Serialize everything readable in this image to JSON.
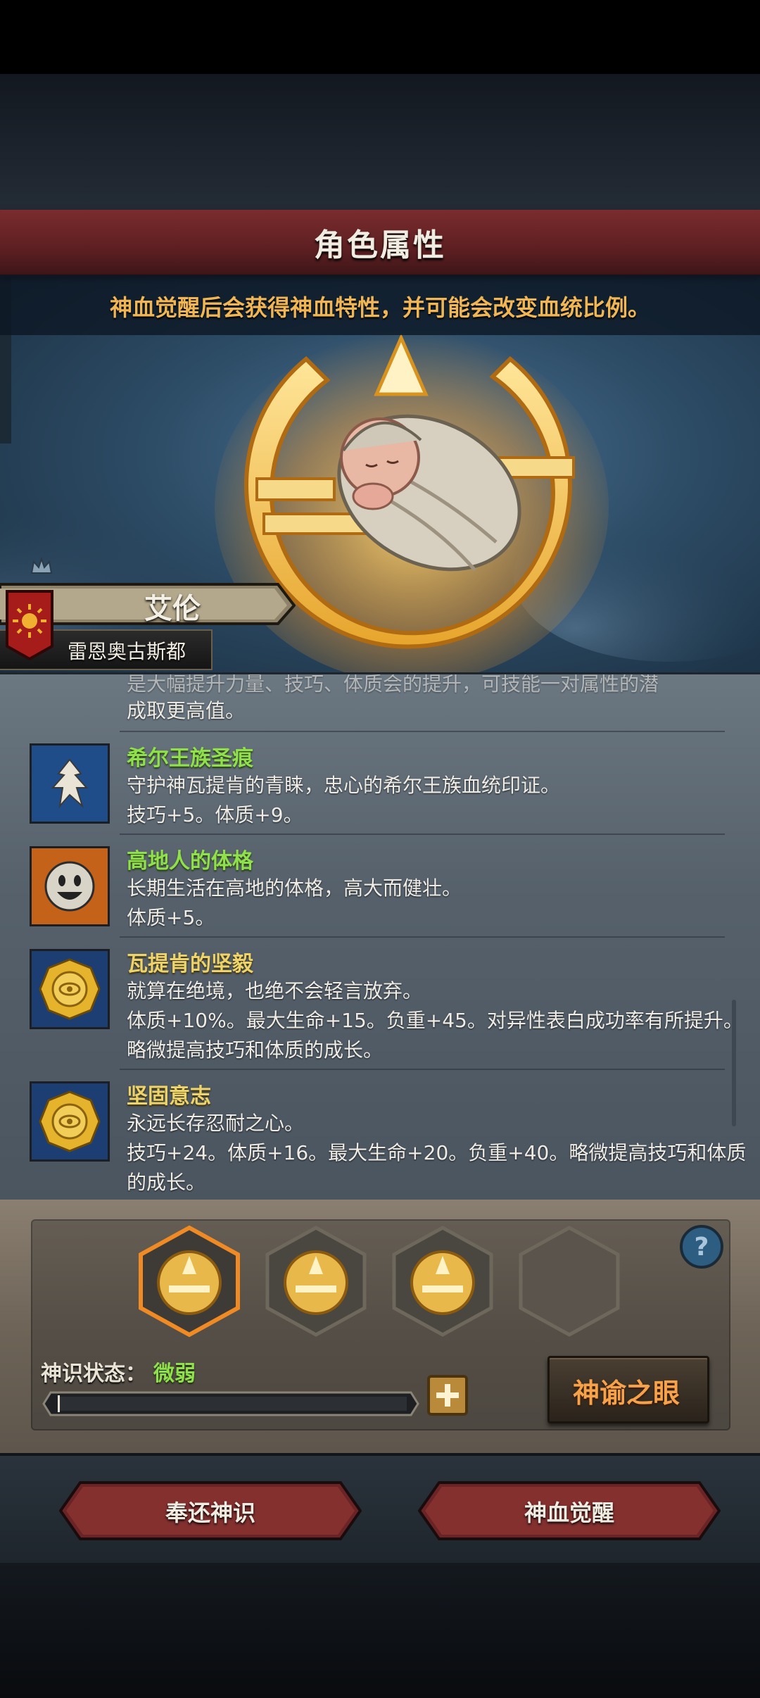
{
  "header": {
    "title": "角色属性"
  },
  "hero": {
    "subtitle": "神血觉醒后会获得神血特性，并可能会改变血统比例。",
    "name": "艾伦",
    "house": "雷恩奥古斯都"
  },
  "traits": {
    "partial_line_top": "是大幅提升力量、技巧、体质会的提升，可技能一对属性的潜",
    "partial_line": "成取更高值。",
    "items": [
      {
        "title": "希尔王族圣痕",
        "desc": "守护神瓦提肯的青睐，忠心的希尔王族血统印证。",
        "effect": "技巧+5。体质+9。",
        "color": "green",
        "icon": "wing-mark-icon"
      },
      {
        "title": "高地人的体格",
        "desc": "长期生活在高地的体格，高大而健壮。",
        "effect": "体质+5。",
        "color": "green",
        "icon": "smiling-face-icon"
      },
      {
        "title": "瓦提肯的坚毅",
        "desc": "就算在绝境，也绝不会轻言放弃。",
        "effect": "体质+10%。最大生命+15。负重+45。对异性表白成功率有所提升。",
        "extra": "略微提高技巧和体质的成长。",
        "color": "gold",
        "icon": "gold-eye-coin-icon"
      },
      {
        "title": "坚固意志",
        "desc": "永远长存忍耐之心。",
        "effect": "技巧+24。体质+16。最大生命+20。负重+40。略微提高技巧和体质",
        "extra": "的成长。",
        "color": "gold",
        "icon": "gold-eye-coin-icon"
      }
    ]
  },
  "panel": {
    "slots": [
      "filled",
      "filled",
      "filled",
      "empty"
    ],
    "state_label": "神识状态：",
    "state_value": "微弱",
    "progress": 0.0,
    "eye_button": "神谕之眼",
    "help_icon": "question-icon"
  },
  "footer": {
    "return_button": "奉还神识",
    "awaken_button": "神血觉醒"
  },
  "colors": {
    "accent_red": "#6a2426",
    "green": "#8fe04a",
    "gold": "#ecd36a",
    "orange": "#f5a24a"
  }
}
